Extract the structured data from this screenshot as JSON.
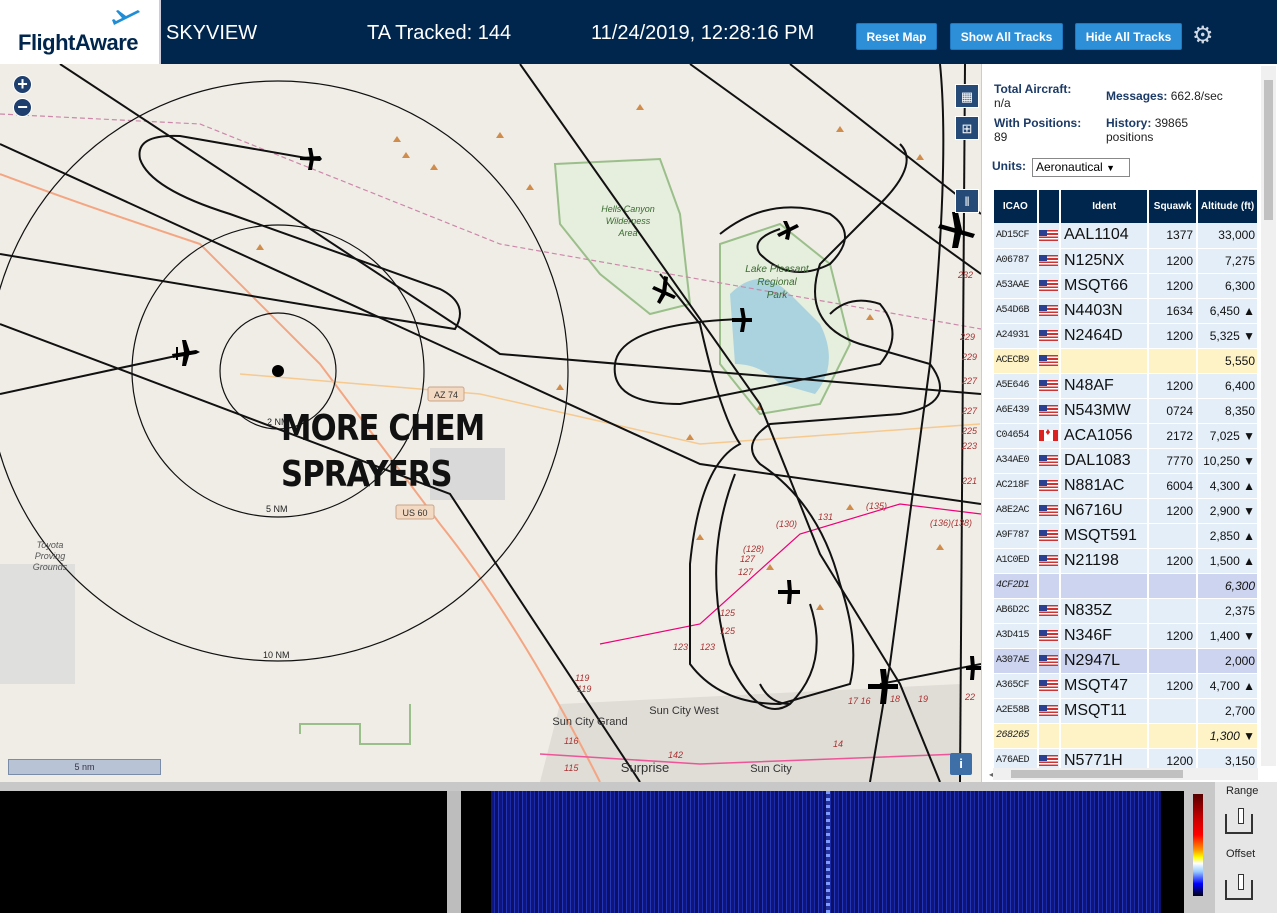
{
  "header": {
    "logo_text": "FlightAware",
    "app_name": "SKYVIEW",
    "tracked_text": "TA Tracked: 144",
    "datetime": "11/24/2019, 12:28:16 PM",
    "buttons": {
      "reset": "Reset Map",
      "show_all": "Show All Tracks",
      "hide_all": "Hide All Tracks"
    },
    "settings_icon": "gear-icon"
  },
  "map": {
    "annotation_line1": "MORE CHEM",
    "annotation_line2": "SPRAYERS",
    "range_labels": [
      "2 NM",
      "5 NM",
      "10 NM"
    ],
    "place_labels": [
      "Hells Canyon Wilderness Area",
      "Lake Pleasant Regional Park",
      "Toyota Proving Grounds",
      "Sun City Grand",
      "Sun City West",
      "Surprise",
      "Sun City"
    ],
    "road_labels": [
      "AZ 74",
      "US 60"
    ],
    "scale": "5 nm",
    "zoom_in": "+",
    "zoom_out": "−",
    "info": "i"
  },
  "stats": {
    "total_label": "Total Aircraft:",
    "total_value": "n/a",
    "messages_label": "Messages:",
    "messages_value": "662.8/sec",
    "positions_label": "With Positions:",
    "positions_value": "89",
    "history_label": "History:",
    "history_value": "39865",
    "history_unit": "positions",
    "units_label": "Units:",
    "units_value": "Aeronautical"
  },
  "table": {
    "headers": {
      "icao": "ICAO",
      "ident": "Ident",
      "squawk": "Squawk",
      "altitude": "Altitude (ft)"
    },
    "rows": [
      {
        "icao": "AD15CF",
        "flag": "us",
        "ident": "AAL1104",
        "squawk": "1377",
        "alt": "33,000",
        "style": ""
      },
      {
        "icao": "A06787",
        "flag": "us",
        "ident": "N125NX",
        "squawk": "1200",
        "alt": "7,275",
        "style": ""
      },
      {
        "icao": "A53AAE",
        "flag": "us",
        "ident": "MSQT66",
        "squawk": "1200",
        "alt": "6,300",
        "style": ""
      },
      {
        "icao": "A54D6B",
        "flag": "us",
        "ident": "N4403N",
        "squawk": "1634",
        "alt": "6,450 ▲",
        "style": ""
      },
      {
        "icao": "A24931",
        "flag": "us",
        "ident": "N2464D",
        "squawk": "1200",
        "alt": "5,325 ▼",
        "style": ""
      },
      {
        "icao": "ACECB9",
        "flag": "us",
        "ident": "",
        "squawk": "",
        "alt": "5,550",
        "style": "yel"
      },
      {
        "icao": "A5E646",
        "flag": "us",
        "ident": "N48AF",
        "squawk": "1200",
        "alt": "6,400",
        "style": ""
      },
      {
        "icao": "A6E439",
        "flag": "us",
        "ident": "N543MW",
        "squawk": "0724",
        "alt": "8,350",
        "style": ""
      },
      {
        "icao": "C04654",
        "flag": "ca",
        "ident": "ACA1056",
        "squawk": "2172",
        "alt": "7,025 ▼",
        "style": ""
      },
      {
        "icao": "A34AE0",
        "flag": "us",
        "ident": "DAL1083",
        "squawk": "7770",
        "alt": "10,250 ▼",
        "style": ""
      },
      {
        "icao": "AC218F",
        "flag": "us",
        "ident": "N881AC",
        "squawk": "6004",
        "alt": "4,300 ▲",
        "style": ""
      },
      {
        "icao": "A8E2AC",
        "flag": "us",
        "ident": "N6716U",
        "squawk": "1200",
        "alt": "2,900 ▼",
        "style": ""
      },
      {
        "icao": "A9F787",
        "flag": "us",
        "ident": "MSQT591",
        "squawk": "",
        "alt": "2,850 ▲",
        "style": ""
      },
      {
        "icao": "A1C0ED",
        "flag": "us",
        "ident": "N21198",
        "squawk": "1200",
        "alt": "1,500 ▲",
        "style": ""
      },
      {
        "icao": "4CF2D1",
        "flag": "",
        "ident": "",
        "squawk": "",
        "alt": "6,300",
        "style": "blu ital"
      },
      {
        "icao": "AB6D2C",
        "flag": "us",
        "ident": "N835Z",
        "squawk": "",
        "alt": "2,375",
        "style": ""
      },
      {
        "icao": "A3D415",
        "flag": "us",
        "ident": "N346F",
        "squawk": "1200",
        "alt": "1,400 ▼",
        "style": ""
      },
      {
        "icao": "A307AE",
        "flag": "us",
        "ident": "N2947L",
        "squawk": "",
        "alt": "2,000",
        "style": "blu"
      },
      {
        "icao": "A365CF",
        "flag": "us",
        "ident": "MSQT47",
        "squawk": "1200",
        "alt": "4,700 ▲",
        "style": ""
      },
      {
        "icao": "A2E58B",
        "flag": "us",
        "ident": "MSQT11",
        "squawk": "",
        "alt": "2,700",
        "style": ""
      },
      {
        "icao": "268265",
        "flag": "",
        "ident": "",
        "squawk": "",
        "alt": "1,300 ▼",
        "style": "yel ital"
      },
      {
        "icao": "A76AED",
        "flag": "us",
        "ident": "N5771H",
        "squawk": "1200",
        "alt": "3,150",
        "style": ""
      }
    ]
  },
  "spectrum": {
    "range_label": "Range",
    "offset_label": "Offset"
  }
}
